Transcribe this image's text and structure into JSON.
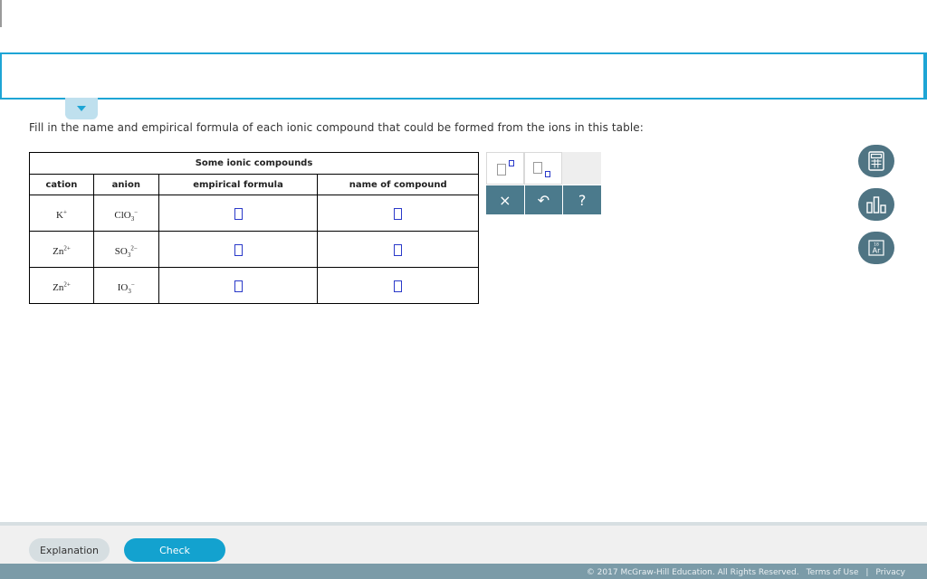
{
  "instructions": "Fill in the name and empirical formula of each ionic compound that could be formed from the ions in this table:",
  "table": {
    "caption": "Some ionic compounds",
    "headers": {
      "cation": "cation",
      "anion": "anion",
      "formula": "empirical formula",
      "name": "name of compound"
    },
    "rows": [
      {
        "cation": {
          "base": "K",
          "charge": "+"
        },
        "anion": {
          "base": "ClO",
          "sub": "3",
          "charge": "−"
        }
      },
      {
        "cation": {
          "base": "Zn",
          "charge": "2+"
        },
        "anion": {
          "base": "SO",
          "sub": "3",
          "charge": "2−"
        }
      },
      {
        "cation": {
          "base": "Zn",
          "charge": "2+"
        },
        "anion": {
          "base": "IO",
          "sub": "3",
          "charge": "−"
        }
      }
    ]
  },
  "toolbar": {
    "clear_glyph": "×",
    "undo_glyph": "↶",
    "help_glyph": "?"
  },
  "side_tools": {
    "periodic_number": "18",
    "periodic_symbol": "Ar"
  },
  "footer": {
    "explanation_label": "Explanation",
    "check_label": "Check",
    "copyright": "© 2017 McGraw-Hill Education. All Rights Reserved.",
    "terms": "Terms of Use",
    "separator": "|",
    "privacy": "Privacy"
  },
  "colors": {
    "accent": "#1ea5d5",
    "check_button": "#13a2cf",
    "tool_button": "#4b7a8c",
    "side_button": "#4f7483",
    "answer_box": "#2a39c9",
    "copyright_bar": "#7b9ba8"
  }
}
